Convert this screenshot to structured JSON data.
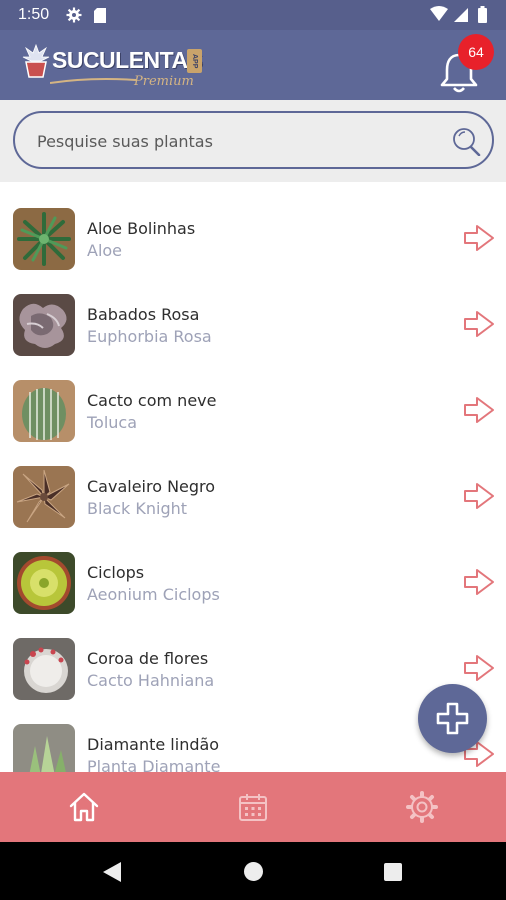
{
  "status_bar": {
    "time": "1:50"
  },
  "header": {
    "logo_text": "SUCULENTAS",
    "logo_tag": "APP",
    "logo_subtitle": "Premium",
    "notification_count": "64"
  },
  "search": {
    "placeholder": "Pesquise suas plantas"
  },
  "plants": [
    {
      "name": "Aloe Bolinhas",
      "species": "Aloe"
    },
    {
      "name": "Babados Rosa",
      "species": "Euphorbia Rosa"
    },
    {
      "name": "Cacto com neve",
      "species": "Toluca"
    },
    {
      "name": "Cavaleiro Negro",
      "species": "Black Knight"
    },
    {
      "name": "Ciclops",
      "species": "Aeonium Ciclops"
    },
    {
      "name": "Coroa de flores",
      "species": "Cacto Hahniana"
    },
    {
      "name": "Diamante lindão",
      "species": "Planta Diamante"
    }
  ],
  "bottom_nav": [
    {
      "icon": "home-icon"
    },
    {
      "icon": "calendar-icon"
    },
    {
      "icon": "settings-icon"
    }
  ],
  "colors": {
    "header": "#5e6897",
    "status_bar": "#575f8c",
    "bottom_nav": "#e3767b",
    "arrow": "#e3767b",
    "badge": "#e8212a",
    "species_text": "#9ea2b7"
  }
}
